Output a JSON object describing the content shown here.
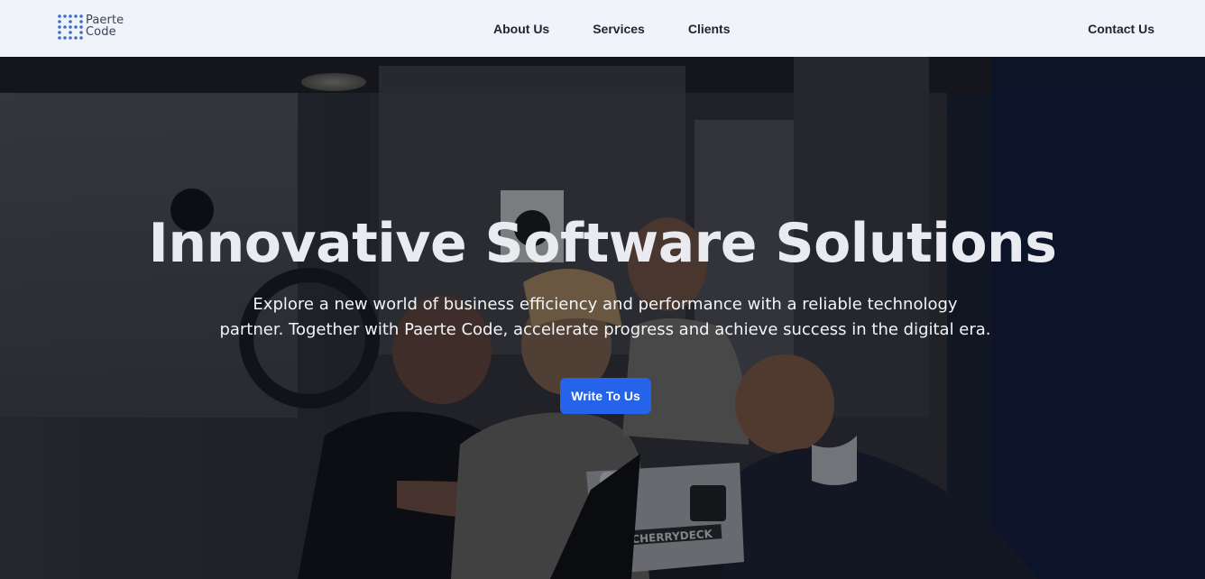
{
  "brand": {
    "line1": "Paerte",
    "line2": "Code",
    "logo_icon": "dot-grid-icon",
    "logo_color": "#3b6fc4"
  },
  "nav": {
    "links": [
      {
        "label": "About Us"
      },
      {
        "label": "Services"
      },
      {
        "label": "Clients"
      }
    ],
    "contact_label": "Contact Us"
  },
  "hero": {
    "title": "Innovative Software Solutions",
    "subtitle": "Explore a new world of business efficiency and performance with a reliable technology partner. Together with Paerte Code, accelerate progress and achieve success in the digital era.",
    "cta_label": "Write To Us",
    "background_image": "team-working-around-laptop-photo",
    "laptop_sticker_text": "CHERRYDECK"
  },
  "colors": {
    "navbar_bg": "#f0f3f9",
    "nav_text": "#1e2433",
    "cta_bg": "#2563eb",
    "hero_text": "#e9ebf1"
  }
}
